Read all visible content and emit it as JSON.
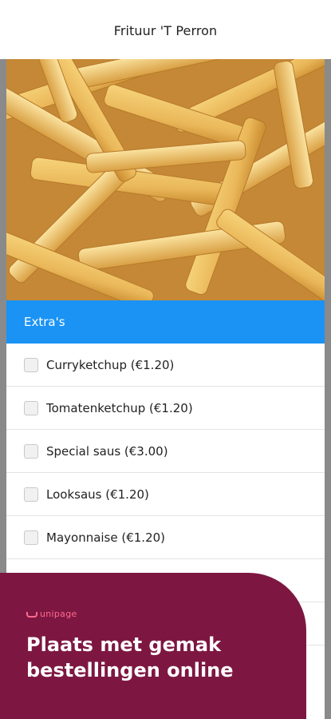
{
  "header": {
    "title": "Frituur 'T Perron"
  },
  "hero": {
    "image_desc": "fries-photo"
  },
  "extras": {
    "title": "Extra's",
    "items": [
      {
        "label": "Curryketchup (€1.20)"
      },
      {
        "label": "Tomatenketchup (€1.20)"
      },
      {
        "label": "Special saus (€3.00)"
      },
      {
        "label": "Looksaus (€1.20)"
      },
      {
        "label": "Mayonnaise (€1.20)"
      },
      {
        "label": ""
      },
      {
        "label": ""
      }
    ]
  },
  "promo": {
    "brand": "unipage",
    "headline": "Plaats met gemak bestellingen online",
    "bg_color": "#7d1742",
    "accent_color": "#ff6a8e"
  },
  "colors": {
    "section_header": "#1a93f5"
  }
}
